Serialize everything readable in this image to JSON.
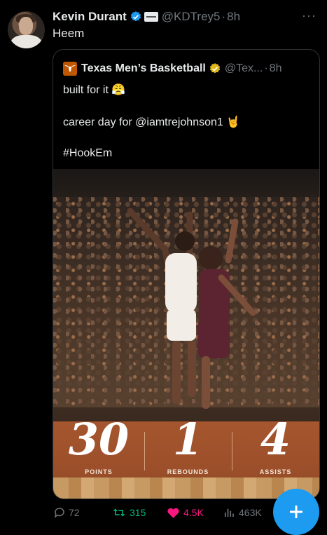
{
  "tweet": {
    "author_name": "Kevin Durant",
    "author_handle": "@KDTrey5",
    "separator": "·",
    "time": "8h",
    "text": "Heem"
  },
  "quoted": {
    "author_name": "Texas Men’s Basketball",
    "author_handle": "@Tex...",
    "separator": "·",
    "time": "8h",
    "line1": "built for it 😤",
    "line2": "career day for @iamtrejohnson1 🤘",
    "line3": "#HookEm",
    "stats": [
      {
        "value": "30",
        "label": "POINTS"
      },
      {
        "value": "1",
        "label": "REBOUNDS"
      },
      {
        "value": "4",
        "label": "ASSISTS"
      }
    ]
  },
  "actions": {
    "replies": "72",
    "retweets": "315",
    "likes": "4.5K",
    "views": "463K"
  },
  "colors": {
    "background": "#000000",
    "accent_blue": "#1d9bf0",
    "retweet_green": "#00ba7c",
    "like_pink": "#f91880",
    "muted_gray": "#71767b",
    "texas_orange": "#bf5700"
  },
  "icons": [
    "verified-badge-icon",
    "affiliate-badge-icon",
    "more-icon",
    "longhorn-logo-icon",
    "gold-verified-icon",
    "reply-icon",
    "retweet-icon",
    "like-icon",
    "views-icon",
    "compose-plus-icon"
  ]
}
